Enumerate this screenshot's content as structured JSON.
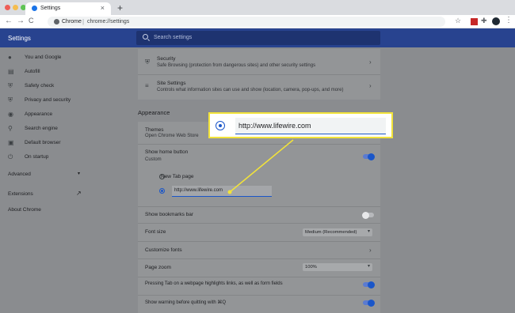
{
  "browser": {
    "tab_title": "Settings",
    "tab_close": "×",
    "new_tab": "+",
    "omnibox_site": "Chrome",
    "omnibox_separator": "|",
    "omnibox_url": "chrome://settings",
    "nav_back": "←",
    "nav_forward": "→",
    "nav_reload": "C",
    "star": "☆",
    "puzzle": "✚",
    "menu": "⋮",
    "traffic_colors": [
      "#ee5e57",
      "#f5bd4f",
      "#5fc454"
    ],
    "accent": "#28438f"
  },
  "header": {
    "title": "Settings",
    "search_placeholder": "Search settings"
  },
  "sidebar": {
    "items": [
      {
        "label": "You and Google",
        "icon": "person-icon"
      },
      {
        "label": "Autofill",
        "icon": "clipboard-icon"
      },
      {
        "label": "Safety check",
        "icon": "shield-check-icon"
      },
      {
        "label": "Privacy and security",
        "icon": "shield-icon"
      },
      {
        "label": "Appearance",
        "icon": "palette-icon"
      },
      {
        "label": "Search engine",
        "icon": "search-icon"
      },
      {
        "label": "Default browser",
        "icon": "browser-icon"
      },
      {
        "label": "On startup",
        "icon": "power-icon"
      }
    ],
    "advanced": "Advanced",
    "extensions": "Extensions",
    "about": "About Chrome"
  },
  "privacy_card": {
    "security_title": "Security",
    "security_sub": "Safe Browsing (protection from dangerous sites) and other security settings",
    "site_title": "Site Settings",
    "site_sub": "Controls what information sites can use and show (location, camera, pop-ups, and more)"
  },
  "appearance": {
    "section_title": "Appearance",
    "themes_title": "Themes",
    "themes_sub": "Open Chrome Web Store",
    "home_button_title": "Show home button",
    "home_button_sub": "Custom",
    "home_button_on": true,
    "radio_new_tab": "New Tab page",
    "home_url": "http://www.lifewire.com",
    "bookmarks_bar": "Show bookmarks bar",
    "bookmarks_on": false,
    "font_size_label": "Font size",
    "font_size_value": "Medium (Recommended)",
    "customize_fonts": "Customize fonts",
    "page_zoom_label": "Page zoom",
    "page_zoom_value": "100%",
    "tab_highlight": "Pressing Tab on a webpage highlights links, as well as form fields",
    "tab_highlight_on": true,
    "quit_warning": "Show warning before quitting with ⌘Q",
    "quit_warning_on": true
  },
  "callout": {
    "url": "http://www.lifewire.com",
    "border_color": "#f2e33a"
  }
}
